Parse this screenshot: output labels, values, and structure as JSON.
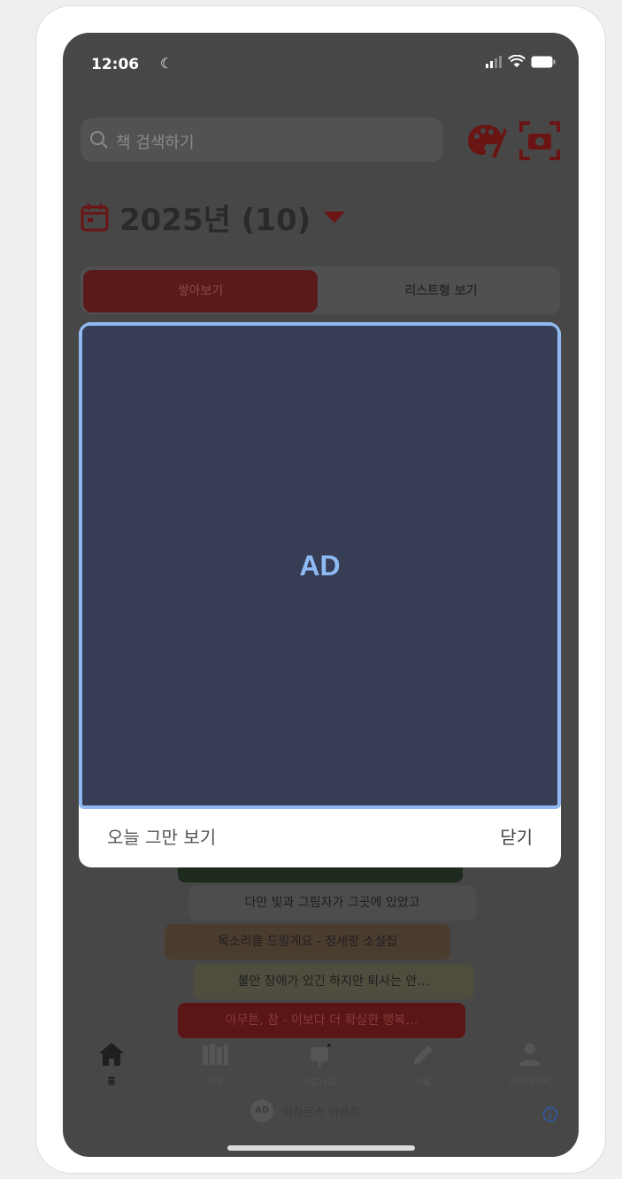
{
  "status_bar": {
    "time": "12:06",
    "moon_icon": "moon-icon",
    "signal_icon": "signal-icon",
    "wifi_icon": "wifi-icon",
    "battery_icon": "battery-icon"
  },
  "search": {
    "placeholder": "책 검색하기"
  },
  "header": {
    "year_label": "2025년 (10)"
  },
  "tabs": {
    "stack": "쌓아보기",
    "list": "리스트형 보기"
  },
  "books": [
    {
      "title": ""
    },
    {
      "title": "다만 빛과 그림자가 그곳에 있었고"
    },
    {
      "title": "목소리를 드릴게요 - 정세랑 소설집"
    },
    {
      "title": "불안 장애가 있긴 하지만 퇴사는 안…"
    },
    {
      "title": "아무튼, 잠 - 이보다 더 확실한 행복…"
    }
  ],
  "nav": [
    {
      "label": "홈",
      "icon": "home-icon"
    },
    {
      "label": "서재",
      "icon": "library-icon"
    },
    {
      "label": "커뮤니티",
      "icon": "community-icon"
    },
    {
      "label": "기록",
      "icon": "pencil-icon"
    },
    {
      "label": "마이페이지",
      "icon": "person-icon"
    }
  ],
  "ad_strip": {
    "badge": "AD",
    "text": "이하몬스 이벤트"
  },
  "modal": {
    "ad_label": "AD",
    "dismiss_today": "오늘 그만 보기",
    "close": "닫기"
  },
  "colors": {
    "accent": "#c03030",
    "ad_border": "#8fb9f2",
    "ad_bg": "#363d54",
    "overlay_bg": "#474747"
  }
}
